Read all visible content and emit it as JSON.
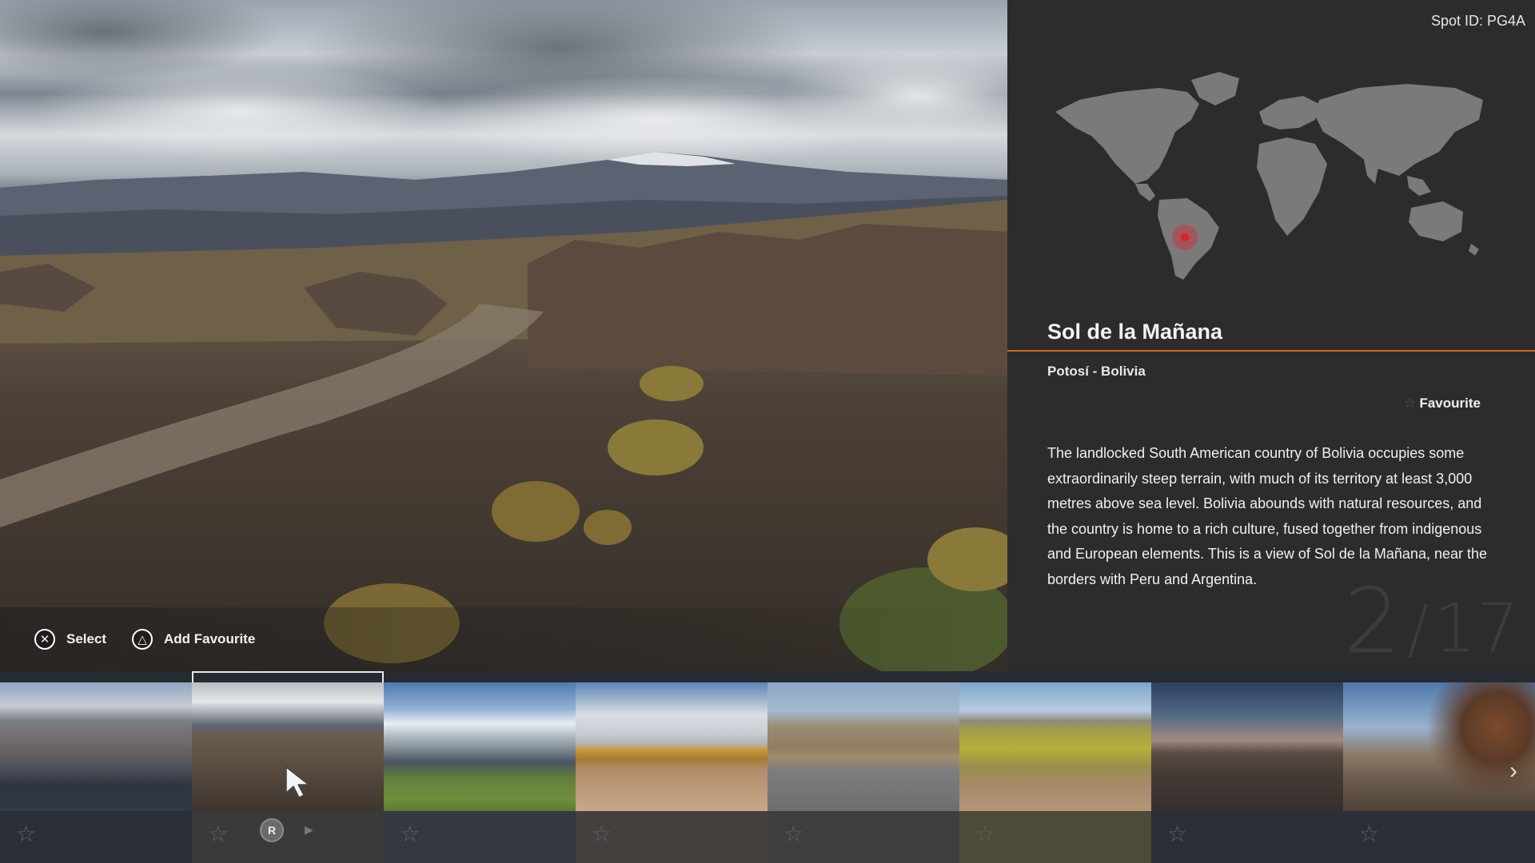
{
  "header": {
    "spot_id": "Spot ID: PG4A"
  },
  "spot": {
    "title": "Sol de la Mañana",
    "location": "Potosí - Bolivia",
    "favourite_label": "Favourite",
    "description": "The landlocked South American country of Bolivia occupies some extraordinarily steep terrain, with much of its territory at least 3,000 metres above sea level. Bolivia abounds with natural resources, and the country is home to a rich culture, fused together from indigenous and European elements. This is a view of Sol de la Mañana, near the borders with Peru and Argentina.",
    "page_current": "2",
    "page_separator": "/",
    "page_total": "17"
  },
  "controls": {
    "select_icon": "cross-button-icon",
    "select_label": "Select",
    "favourite_icon": "triangle-button-icon",
    "favourite_label": "Add Favourite"
  },
  "map": {
    "marker_color": "#e0202a",
    "land_color": "#7a7a7a"
  },
  "thumbnail_strip": {
    "selected_index": 1,
    "r_button_label": "R",
    "thumbnails": [
      {
        "scene": "city-view",
        "favourite": false
      },
      {
        "scene": "sol-de-la-manana",
        "favourite": false
      },
      {
        "scene": "lagoon",
        "favourite": false
      },
      {
        "scene": "village-house",
        "favourite": false
      },
      {
        "scene": "desert-road",
        "favourite": false
      },
      {
        "scene": "grassland",
        "favourite": false
      },
      {
        "scene": "train-cemetery-dusk",
        "favourite": false
      },
      {
        "scene": "train-cemetery-locomotive",
        "favourite": false
      }
    ]
  },
  "colors": {
    "accent": "#d9641e",
    "panel": "#2c2c2c",
    "strip": "#262a31"
  }
}
